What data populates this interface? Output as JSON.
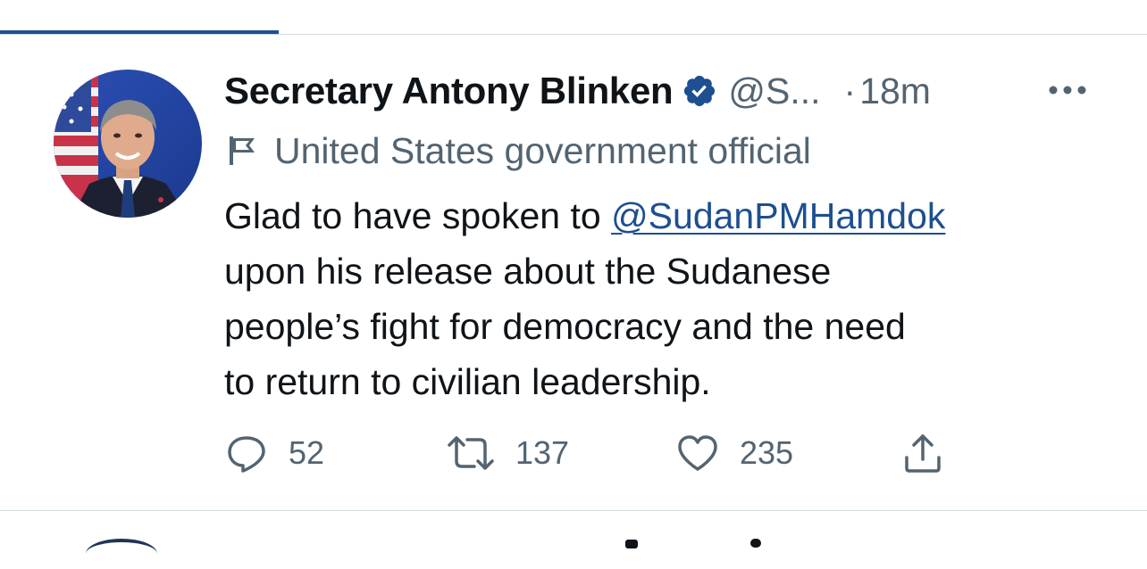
{
  "tweet": {
    "display_name": "Secretary Antony Blinken",
    "handle": "@S...",
    "separator": "·",
    "time": "18m",
    "label": "United States government official",
    "text_line_1_prefix": "Glad to have spoken to ",
    "mention": "@SudanPMHamdok",
    "text_line_2": "upon his release about the Sudanese",
    "text_line_3": "people’s fight for democracy and the need",
    "text_line_4": "to return to civilian leadership.",
    "reply_count": "52",
    "retweet_count": "137",
    "like_count": "235"
  },
  "colors": {
    "accent": "#1d4f91",
    "secondary_text": "#536471",
    "primary_text": "#0f1419",
    "divider": "#cfd9de"
  },
  "icons": {
    "verified": "verified-badge-icon",
    "label": "flag-icon",
    "more": "more-horizontal-icon",
    "reply": "reply-icon",
    "retweet": "retweet-icon",
    "like": "heart-icon",
    "share": "share-icon"
  }
}
